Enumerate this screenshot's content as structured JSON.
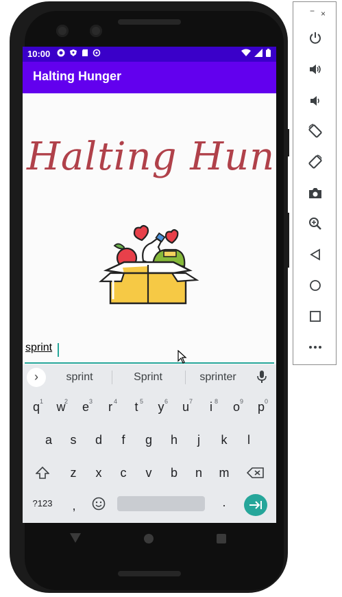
{
  "status_bar": {
    "time": "10:00",
    "left_icons": [
      "gear-icon",
      "shield-icon",
      "sd-card-icon",
      "sync-icon"
    ],
    "right_icons": [
      "wifi-icon",
      "signal-icon",
      "battery-icon"
    ]
  },
  "app_bar": {
    "title": "Halting Hunger"
  },
  "headline": "Halting Hunger",
  "text_field": {
    "value": "sprint"
  },
  "keyboard": {
    "suggestions": [
      "sprint",
      "Sprint",
      "sprinter"
    ],
    "row1": [
      {
        "k": "q",
        "n": "1"
      },
      {
        "k": "w",
        "n": "2"
      },
      {
        "k": "e",
        "n": "3"
      },
      {
        "k": "r",
        "n": "4"
      },
      {
        "k": "t",
        "n": "5"
      },
      {
        "k": "y",
        "n": "6"
      },
      {
        "k": "u",
        "n": "7"
      },
      {
        "k": "i",
        "n": "8"
      },
      {
        "k": "o",
        "n": "9"
      },
      {
        "k": "p",
        "n": "0"
      }
    ],
    "row2": [
      "a",
      "s",
      "d",
      "f",
      "g",
      "h",
      "j",
      "k",
      "l"
    ],
    "row3": [
      "z",
      "x",
      "c",
      "v",
      "b",
      "n",
      "m"
    ],
    "symbols_label": "?123",
    "comma": ",",
    "period": "."
  },
  "sidebar": {
    "minimize": "−",
    "close": "×",
    "buttons": [
      "power-icon",
      "volume-up-icon",
      "volume-down-icon",
      "rotate-left-icon",
      "rotate-right-icon",
      "camera-icon",
      "zoom-icon",
      "back-icon",
      "home-icon",
      "overview-icon",
      "more-icon"
    ]
  },
  "colors": {
    "status_bar": "#3a00c9",
    "app_bar": "#6200ee",
    "accent": "#26a69a",
    "headline": "#b0414a"
  }
}
